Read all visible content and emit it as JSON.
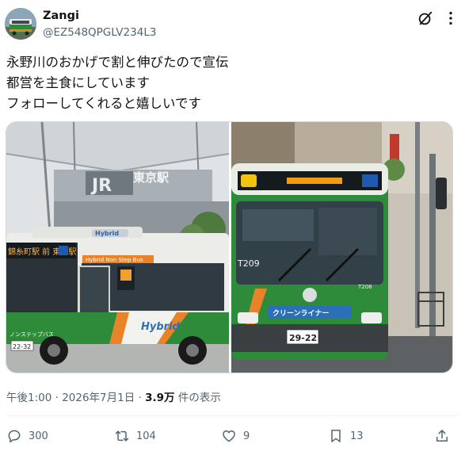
{
  "author": {
    "name": "Zangi",
    "handle": "@EZ548QPGLV234L3",
    "avatar_icon": "bus-avatar"
  },
  "tweet": {
    "lines": [
      "永野川のおかげで割と伸びたので宣伝",
      "都営を主食にしています",
      "フォローしてくれると嬉しいです"
    ]
  },
  "media": {
    "photo1": {
      "sign": "東京駅",
      "badge": "Hybrid",
      "body_label": "Hybrid",
      "side_text": "Hybrid Non Step Bus",
      "destination": "錦糸町駅 前 東京駅",
      "plate": "22-32",
      "company_label": "ノンステップバス"
    },
    "photo2": {
      "fleet_no": "T209",
      "fleet_no_front": "T208",
      "grille_text": "クリーンライナー",
      "plate": "29-22"
    }
  },
  "meta": {
    "timestamp": "午後1:00 · 2026年7月1日 · ",
    "views_count": "3.9万",
    "views_label": " 件の表示"
  },
  "actions": {
    "replies": "300",
    "reposts": "104",
    "likes": "9",
    "bookmarks": "13"
  },
  "colors": {
    "text_primary": "#0f1419",
    "text_secondary": "#536471",
    "border": "#cfd9de",
    "bus_green": "#2e8b3a",
    "bus_orange": "#e8832a"
  }
}
